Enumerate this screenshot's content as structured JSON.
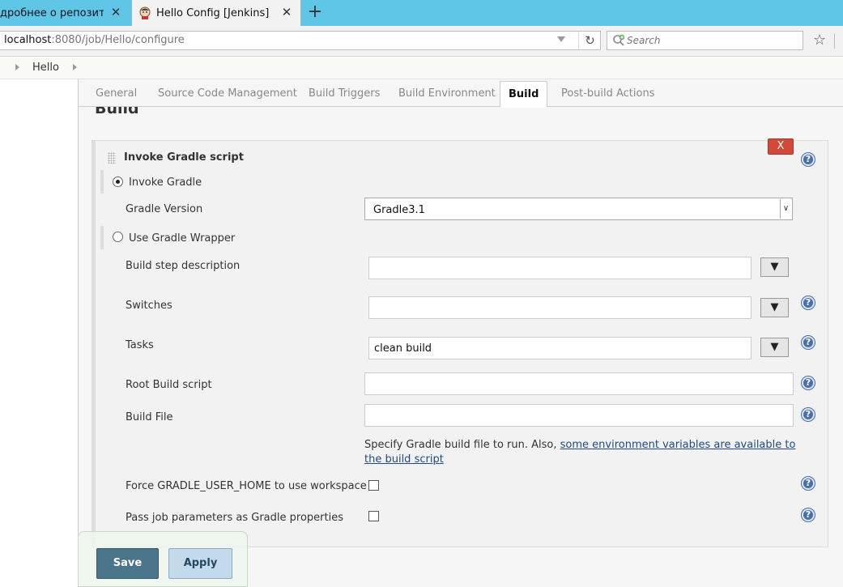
{
  "browser": {
    "tabs": [
      {
        "title": "дробнее о репозитор…",
        "active": false
      },
      {
        "title": "Hello Config [Jenkins]",
        "active": true
      }
    ],
    "url_host": "localhost",
    "url_rest": ":8080/job/Hello/configure",
    "search_placeholder": "Search"
  },
  "breadcrumb": {
    "items": [
      "Hello"
    ]
  },
  "config_tabs": [
    "General",
    "Source Code Management",
    "Build Triggers",
    "Build Environment",
    "Build",
    "Post-build Actions"
  ],
  "active_tab": "Build",
  "section_title": "Build",
  "step": {
    "title": "Invoke Gradle script",
    "delete_label": "X",
    "invoke_gradle_label": "Invoke Gradle",
    "invoke_gradle_selected": true,
    "gradle_version_label": "Gradle Version",
    "gradle_version_value": "Gradle3.1",
    "wrapper_label": "Use Gradle Wrapper",
    "wrapper_selected": false,
    "build_step_desc_label": "Build step description",
    "build_step_desc_value": "",
    "switches_label": "Switches",
    "switches_value": "",
    "tasks_label": "Tasks",
    "tasks_value": "clean build",
    "root_script_label": "Root Build script",
    "root_script_value": "",
    "build_file_label": "Build File",
    "build_file_value": "",
    "build_file_help_text": "Specify Gradle build file to run. Also, ",
    "build_file_help_link": "some environment variables are available to the build script",
    "force_home_label": "Force GRADLE_USER_HOME to use workspace",
    "force_home_checked": false,
    "pass_params_label": "Pass job parameters as Gradle properties",
    "pass_params_checked": false,
    "expand_glyph": "▼",
    "help_glyph": "?"
  },
  "buttons": {
    "save": "Save",
    "apply": "Apply"
  }
}
